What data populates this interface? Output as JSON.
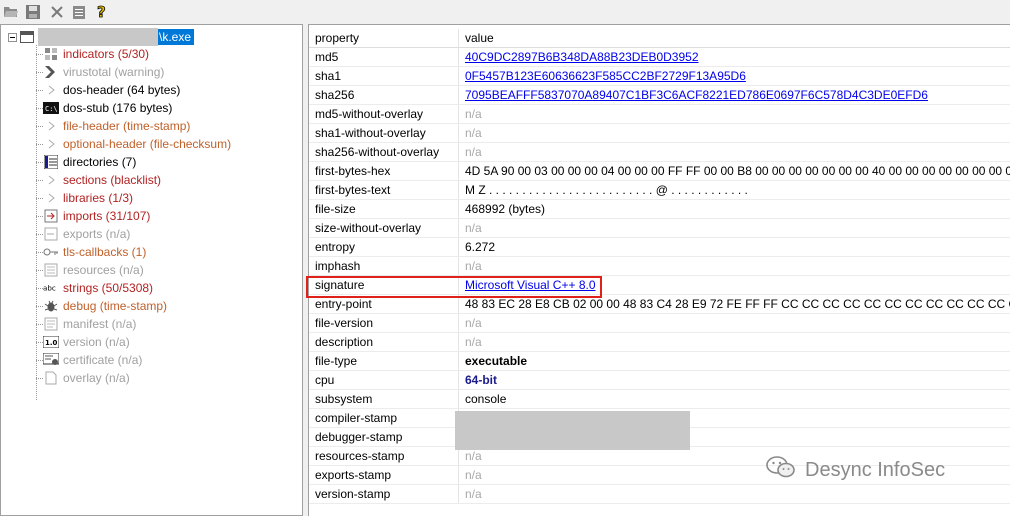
{
  "toolbar": {
    "items": [
      "open-icon",
      "save-icon",
      "close-icon",
      "clipboard-icon",
      "help-icon"
    ]
  },
  "tree": {
    "root_label": "\\k.exe",
    "nodes": [
      {
        "label": "indicators (5/30)",
        "icon": "indicator-icon",
        "color": "#b22222"
      },
      {
        "label": "virustotal (warning)",
        "icon": "virustotal-icon",
        "color": "#a0a0a0"
      },
      {
        "label": "dos-header (64 bytes)",
        "icon": "arrow-icon",
        "color": "#000000"
      },
      {
        "label": "dos-stub (176 bytes)",
        "icon": "console-icon",
        "color": "#000000"
      },
      {
        "label": "file-header (time-stamp)",
        "icon": "arrow-icon",
        "color": "#c0602a"
      },
      {
        "label": "optional-header (file-checksum)",
        "icon": "arrow-icon",
        "color": "#c0602a"
      },
      {
        "label": "directories (7)",
        "icon": "grid-icon",
        "color": "#000000"
      },
      {
        "label": "sections (blacklist)",
        "icon": "arrow-icon",
        "color": "#b22222"
      },
      {
        "label": "libraries (1/3)",
        "icon": "arrow-icon",
        "color": "#b22222"
      },
      {
        "label": "imports (31/107)",
        "icon": "imports-icon",
        "color": "#b22222"
      },
      {
        "label": "exports (n/a)",
        "icon": "exports-icon",
        "color": "#a0a0a0"
      },
      {
        "label": "tls-callbacks (1)",
        "icon": "key-icon",
        "color": "#c0602a"
      },
      {
        "label": "resources (n/a)",
        "icon": "resources-icon",
        "color": "#a0a0a0"
      },
      {
        "label": "strings (50/5308)",
        "icon": "strings-icon",
        "color": "#b22222"
      },
      {
        "label": "debug (time-stamp)",
        "icon": "bug-icon",
        "color": "#c0602a"
      },
      {
        "label": "manifest (n/a)",
        "icon": "manifest-icon",
        "color": "#a0a0a0"
      },
      {
        "label": "version (n/a)",
        "icon": "version-icon",
        "color": "#a0a0a0"
      },
      {
        "label": "certificate (n/a)",
        "icon": "certificate-icon",
        "color": "#a0a0a0"
      },
      {
        "label": "overlay (n/a)",
        "icon": "document-icon",
        "color": "#a0a0a0"
      }
    ]
  },
  "table": {
    "header": {
      "property": "property",
      "value": "value"
    },
    "rows": [
      {
        "property": "md5",
        "value": "40C9DC2897B6B348DA88B23DEB0D3952",
        "style": "link"
      },
      {
        "property": "sha1",
        "value": "0F5457B123E60636623F585CC2BF2729F13A95D6",
        "style": "link"
      },
      {
        "property": "sha256",
        "value": "7095BEAFFF5837070A89407C1BF3C6ACF8221ED786E0697F6C578D4C3DE0EFD6",
        "style": "link"
      },
      {
        "property": "md5-without-overlay",
        "value": "n/a",
        "style": "na"
      },
      {
        "property": "sha1-without-overlay",
        "value": "n/a",
        "style": "na"
      },
      {
        "property": "sha256-without-overlay",
        "value": "n/a",
        "style": "na"
      },
      {
        "property": "first-bytes-hex",
        "value": "4D 5A 90 00 03 00 00 00 04 00 00 00 FF FF 00 00 B8 00 00 00 00 00 00 00 40 00 00 00 00 00 00 00 00",
        "style": "plain"
      },
      {
        "property": "first-bytes-text",
        "value": "M Z . . . . . . . . . . . . . . . . . . . . . . . . . @ . . . . . . . . . . . .",
        "style": "plain"
      },
      {
        "property": "file-size",
        "value": "468992 (bytes)",
        "style": "plain"
      },
      {
        "property": "size-without-overlay",
        "value": "n/a",
        "style": "na"
      },
      {
        "property": "entropy",
        "value": "6.272",
        "style": "plain"
      },
      {
        "property": "imphash",
        "value": "n/a",
        "style": "na"
      },
      {
        "property": "signature",
        "value": "Microsoft Visual C++ 8.0",
        "style": "link"
      },
      {
        "property": "entry-point",
        "value": "48 83 EC 28 E8 CB 02 00 00 48 83 C4 28 E9 72 FE FF FF CC CC CC CC CC CC CC CC CC CC CC CC CC CC CC C...",
        "style": "plain"
      },
      {
        "property": "file-version",
        "value": "n/a",
        "style": "na"
      },
      {
        "property": "description",
        "value": "n/a",
        "style": "na"
      },
      {
        "property": "file-type",
        "value": "executable",
        "style": "bold"
      },
      {
        "property": "cpu",
        "value": "64-bit",
        "style": "blue-bold"
      },
      {
        "property": "subsystem",
        "value": "console",
        "style": "plain"
      },
      {
        "property": "compiler-stamp",
        "value": "",
        "style": "plain"
      },
      {
        "property": "debugger-stamp",
        "value": "",
        "style": "plain"
      },
      {
        "property": "resources-stamp",
        "value": "n/a",
        "style": "na"
      },
      {
        "property": "exports-stamp",
        "value": "n/a",
        "style": "na"
      },
      {
        "property": "version-stamp",
        "value": "n/a",
        "style": "na"
      }
    ]
  },
  "watermark": {
    "text": "Desync InfoSec"
  },
  "colors": {
    "highlight": "#e0201b",
    "selection": "#0078d7",
    "link": "#0000ee"
  }
}
